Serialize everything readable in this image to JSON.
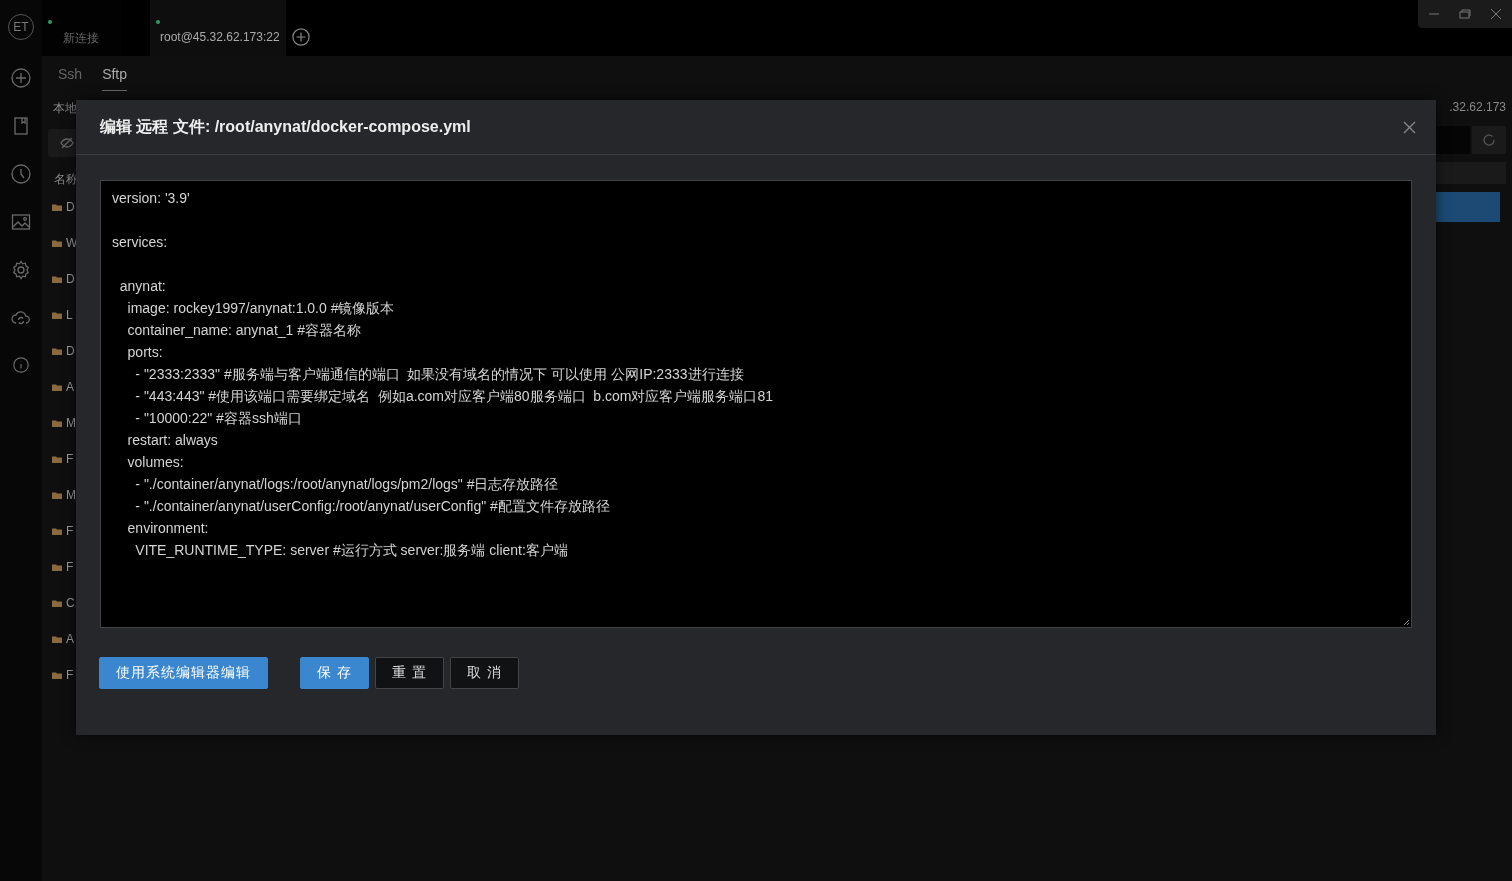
{
  "logo": {
    "text": "ET"
  },
  "connection_tabs": [
    {
      "label": "新连接",
      "selected": false,
      "connected": true
    },
    {
      "label": "root@45.32.62.173:22",
      "selected": true,
      "connected": true
    }
  ],
  "sub_tabs": [
    {
      "label": "Ssh",
      "selected": false
    },
    {
      "label": "Sftp",
      "selected": true
    }
  ],
  "local_panel": {
    "title": "本地",
    "header": "名称",
    "files": [
      {
        "name": "D"
      },
      {
        "name": "W"
      },
      {
        "name": "D"
      },
      {
        "name": "L"
      },
      {
        "name": "D"
      },
      {
        "name": "A"
      },
      {
        "name": "M"
      },
      {
        "name": "F"
      },
      {
        "name": "M"
      },
      {
        "name": "F"
      },
      {
        "name": "F"
      },
      {
        "name": "C"
      },
      {
        "name": "A"
      },
      {
        "name": "F"
      }
    ]
  },
  "remote_panel": {
    "host": ".32.62.173"
  },
  "dialog": {
    "title": "编辑 远程 文件: /root/anynat/docker-compose.yml",
    "blocks": [
      {
        "lines": [
          "version: '3.9'"
        ]
      },
      {
        "lines": [
          "services:"
        ]
      },
      {
        "lines": [
          "  anynat:",
          "    image: rockey1997/anynat:1.0.0 #镜像版本",
          "    container_name: anynat_1 #容器名称",
          "    ports:",
          "      - \"2333:2333\" #服务端与客户端通信的端口  如果没有域名的情况下 可以使用 公网IP:2333进行连接",
          "      - \"443:443\" #使用该端口需要绑定域名  例如a.com对应客户端80服务端口  b.com对应客户端服务端口81",
          "      - \"10000:22\" #容器ssh端口",
          "    restart: always",
          "    volumes:",
          "      - \"./container/anynat/logs:/root/anynat/logs/pm2/logs\" #日志存放路径",
          "      - \"./container/anynat/userConfig:/root/anynat/userConfig\" #配置文件存放路径",
          "    environment:",
          "      VITE_RUNTIME_TYPE: server #运行方式 server:服务端 client:客户端"
        ]
      }
    ],
    "buttons": [
      {
        "label": "使用系统编辑器编辑",
        "kind": "primary"
      },
      {
        "label": "保 存",
        "kind": "primary"
      },
      {
        "label": "重 置",
        "kind": "default"
      },
      {
        "label": "取 消",
        "kind": "default"
      }
    ]
  }
}
